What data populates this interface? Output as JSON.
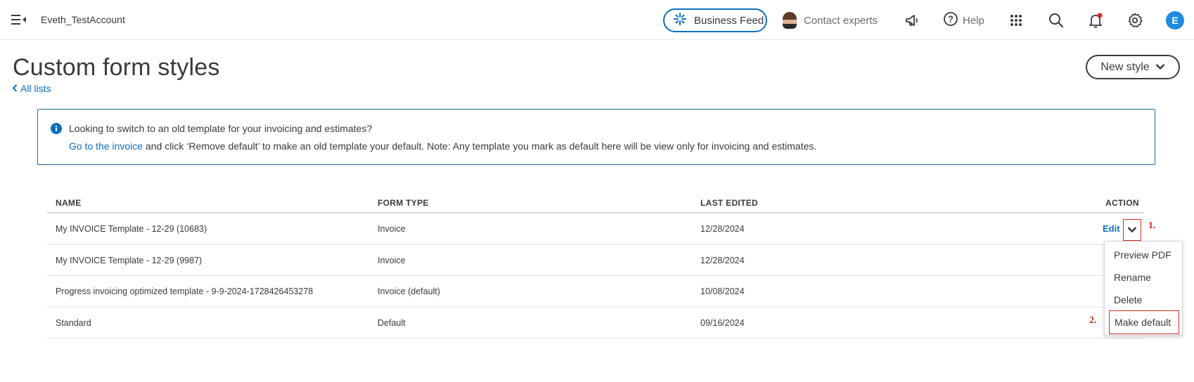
{
  "header": {
    "account_name": "Eveth_TestAccount",
    "business_feed_label": "Business Feed",
    "contact_label": "Contact experts",
    "help_label": "Help",
    "avatar_initial": "E",
    "accent_color": "#0d6fbf",
    "notification_dot_color": "#d52b1e"
  },
  "page": {
    "title": "Custom form styles",
    "back_link": "All lists",
    "new_style_label": "New style"
  },
  "info": {
    "heading": "Looking to switch to an old template for your invoicing and estimates?",
    "link_text": "Go to the invoice",
    "body_text": " and click ‘Remove default’ to make an old template your default. Note: Any template you mark as default here will be view only for invoicing and estimates."
  },
  "table": {
    "headers": [
      "NAME",
      "FORM TYPE",
      "LAST EDITED",
      "ACTION"
    ],
    "rows": [
      {
        "name": "My INVOICE Template - 12-29 (10683)",
        "form_type": "Invoice",
        "last_edited": "12/28/2024",
        "action": "Edit"
      },
      {
        "name": "My INVOICE Template - 12-29 (9987)",
        "form_type": "Invoice",
        "last_edited": "12/28/2024"
      },
      {
        "name": "Progress invoicing optimized template - 9-9-2024-1728426453278",
        "form_type": "Invoice (default)",
        "last_edited": "10/08/2024"
      },
      {
        "name": "Standard",
        "form_type": "Default",
        "last_edited": "09/16/2024"
      }
    ]
  },
  "dropdown": {
    "items": [
      "Preview PDF",
      "Rename",
      "Delete",
      "Make default"
    ]
  },
  "annotations": {
    "step1": "1.",
    "step2": "2.",
    "color": "#d52b1e"
  }
}
